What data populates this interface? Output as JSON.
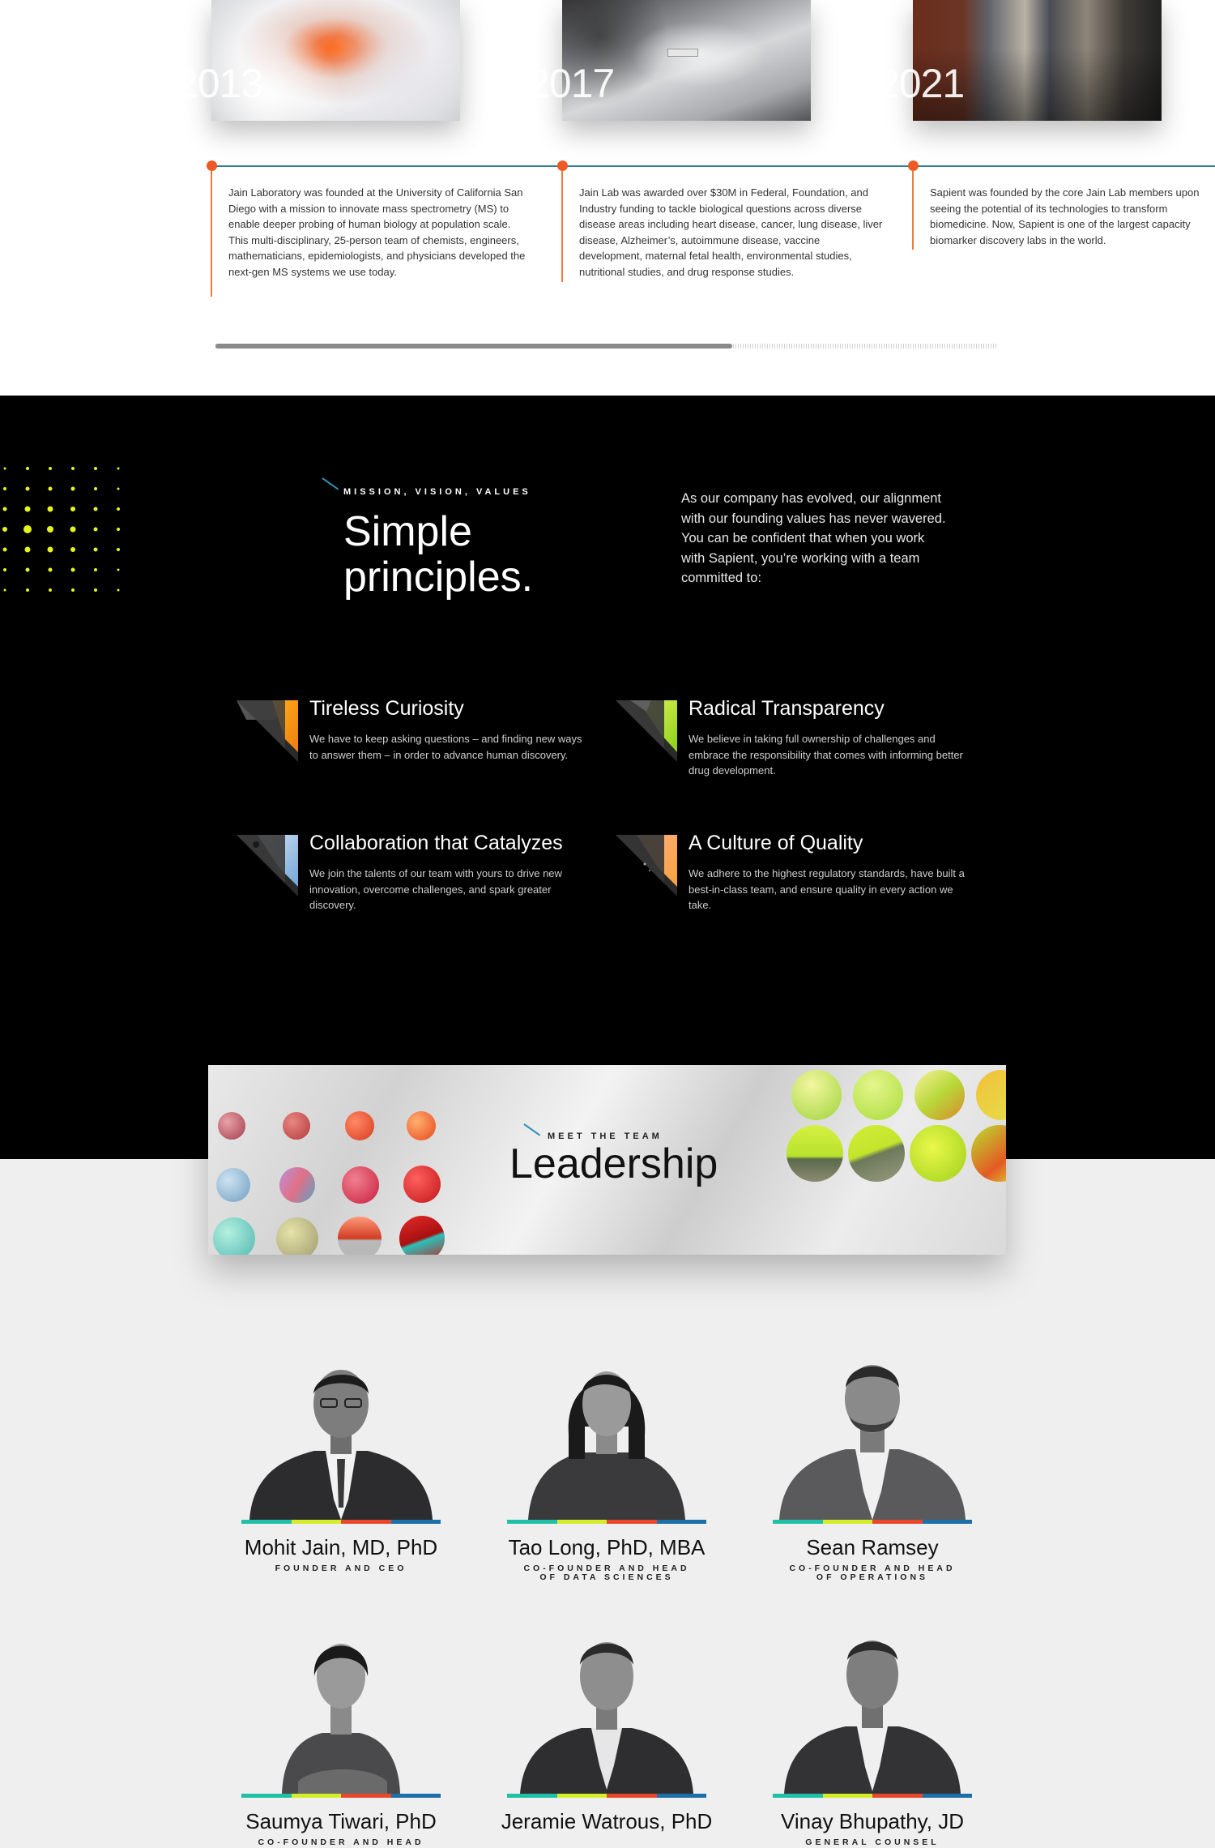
{
  "timeline": {
    "entries": [
      {
        "year": "2013",
        "text": "Jain Laboratory was founded at the University of California San Diego with a mission to innovate mass spectrometry (MS) to enable deeper probing of human biology at population scale. This multi-disciplinary, 25-person team of chemists, engineers, mathematicians, epidemiologists, and physicians developed the next-gen MS systems we use today."
      },
      {
        "year": "2017",
        "text": "Jain Lab was awarded over $30M in Federal, Foundation, and Industry funding to tackle biological questions across diverse disease areas including heart disease, cancer, lung disease, liver disease, Alzheimer’s, autoimmune disease, vaccine development, maternal fetal health, environmental studies, nutritional studies, and drug response studies."
      },
      {
        "year": "2021",
        "text": "Sapient was founded by the core Jain Lab members upon seeing the potential of its technologies to transform biomedicine. Now, Sapient is one of the largest capacity biomarker discovery labs in the world."
      }
    ],
    "scroll_progress": 0.66
  },
  "values": {
    "eyebrow": "MISSION, VISION, VALUES",
    "title_line1": "Simple",
    "title_line2": "principles.",
    "intro": "As our company has evolved, our alignment with our founding values has never wavered. You can be confident that when you work with Sapient, you’re working with a team committed to:",
    "items": [
      {
        "title": "Tireless Curiosity",
        "desc": "We have to keep asking questions – and finding new ways to answer them – in order to advance human discovery.",
        "icon": "orange-triangle-icon"
      },
      {
        "title": "Radical Transparency",
        "desc": "We believe in taking full ownership of challenges and embrace the responsibility that comes with informing better drug development.",
        "icon": "lime-triangle-icon"
      },
      {
        "title": "Collaboration that Catalyzes",
        "desc": "We join the talents of our team with yours to drive new innovation, overcome challenges, and spark greater discovery.",
        "icon": "blue-triangle-icon"
      },
      {
        "title": "A Culture of Quality",
        "desc": "We adhere to the highest regulatory standards, have built a best-in-class team, and ensure quality in every action we take.",
        "icon": "coral-triangle-icon"
      }
    ]
  },
  "leadership": {
    "eyebrow": "MEET THE TEAM",
    "title": "Leadership",
    "people": [
      {
        "name": "Mohit Jain, MD, PhD",
        "role": "Founder and CEO"
      },
      {
        "name": "Tao Long, PhD, MBA",
        "role": "Co-Founder and Head of Data Sciences"
      },
      {
        "name": "Sean Ramsey",
        "role": "Co-Founder and Head of Operations"
      },
      {
        "name": "Saumya Tiwari, PhD",
        "role": "Co-Founder and Head"
      },
      {
        "name": "Jeramie Watrous, PhD",
        "role": ""
      },
      {
        "name": "Vinay Bhupathy, JD",
        "role": "General Counsel"
      }
    ]
  },
  "colors": {
    "accent_orange": "#ee5a24",
    "timeline_teal": "#2f7f95",
    "bar_teal": "#1fbfa8",
    "bar_yellow": "#d6ec2a",
    "bar_red": "#e8472b",
    "bar_blue": "#1d6fa8",
    "dot_yellow": "#e6f51c"
  }
}
